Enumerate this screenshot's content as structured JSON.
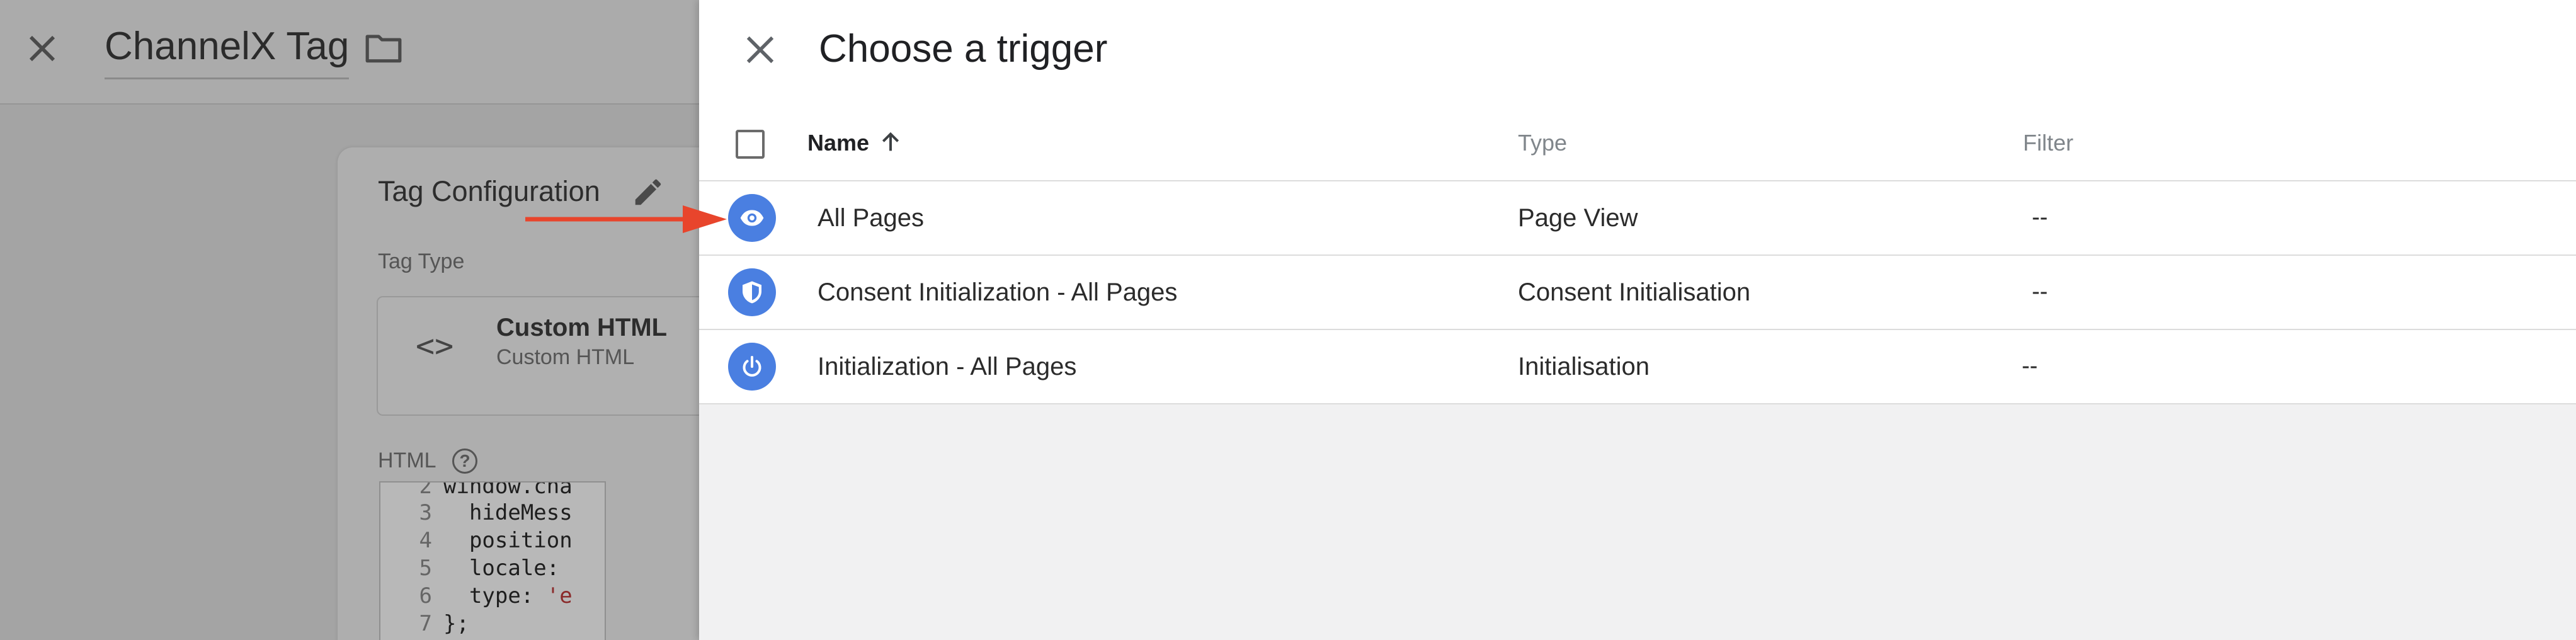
{
  "background": {
    "title": "ChannelX Tag",
    "card_title": "Tag Configuration",
    "tag_type_label": "Tag Type",
    "tag_type_name": "Custom HTML",
    "tag_type_sub": "Custom HTML",
    "code_icon": "<>",
    "html_label": "HTML",
    "help_icon": "?",
    "code_lines": [
      {
        "num": "2",
        "text": "window.cha"
      },
      {
        "num": "3",
        "text": "  hideMess"
      },
      {
        "num": "4",
        "text": "  position"
      },
      {
        "num": "5",
        "text": "  locale:"
      },
      {
        "num": "6",
        "text": "  type: ",
        "str": "'e"
      },
      {
        "num": "7",
        "text": "};"
      }
    ]
  },
  "panel": {
    "title": "Choose a trigger",
    "columns": {
      "name": "Name",
      "type": "Type",
      "filter": "Filter"
    },
    "rows": [
      {
        "name": "All Pages",
        "type": "Page View",
        "filter": "--",
        "icon": "eye-icon"
      },
      {
        "name": "Consent Initialization - All Pages",
        "type": "Consent Initialisation",
        "filter": "--",
        "icon": "shield-icon"
      },
      {
        "name": "Initialization - All Pages",
        "type": "Initialisation",
        "filter": "--",
        "icon": "power-icon"
      }
    ]
  },
  "colors": {
    "accent": "#4a7fe1",
    "annotation_arrow": "#e8452c"
  }
}
